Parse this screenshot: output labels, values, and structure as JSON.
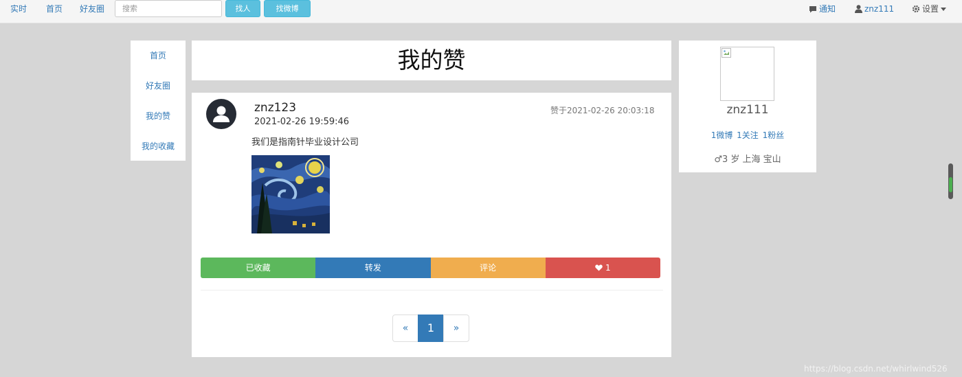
{
  "navbar": {
    "links": [
      "实时",
      "首页",
      "好友圈"
    ],
    "search_placeholder": "搜索",
    "btn_find_people": "找人",
    "btn_find_weibo": "找微博",
    "notify_label": "通知",
    "user_label": "znz111",
    "settings_label": "设置"
  },
  "sidebar": {
    "items": [
      "首页",
      "好友圈",
      "我的赞",
      "我的收藏"
    ]
  },
  "main": {
    "title": "我的赞",
    "post": {
      "user": "znz123",
      "time": "2021-02-26 19:59:46",
      "liked_at": "赞于2021-02-26 20:03:18",
      "text": "我们是指南针毕业设计公司",
      "image_icon": "starry-night-painting"
    },
    "actions": {
      "favorite": "已收藏",
      "repost": "转发",
      "comment": "评论",
      "like_count": "1"
    },
    "action_colors": [
      "#5cb85c",
      "#337ab7",
      "#f0ad4e",
      "#d9534f"
    ],
    "pagination": {
      "prev": "«",
      "current": "1",
      "next": "»"
    }
  },
  "profile": {
    "name": "znz111",
    "stats": [
      "1微博",
      "1关注",
      "1粉丝"
    ],
    "info": "♂3 岁 上海 宝山"
  },
  "watermark": "https://blog.csdn.net/whirlwind526"
}
